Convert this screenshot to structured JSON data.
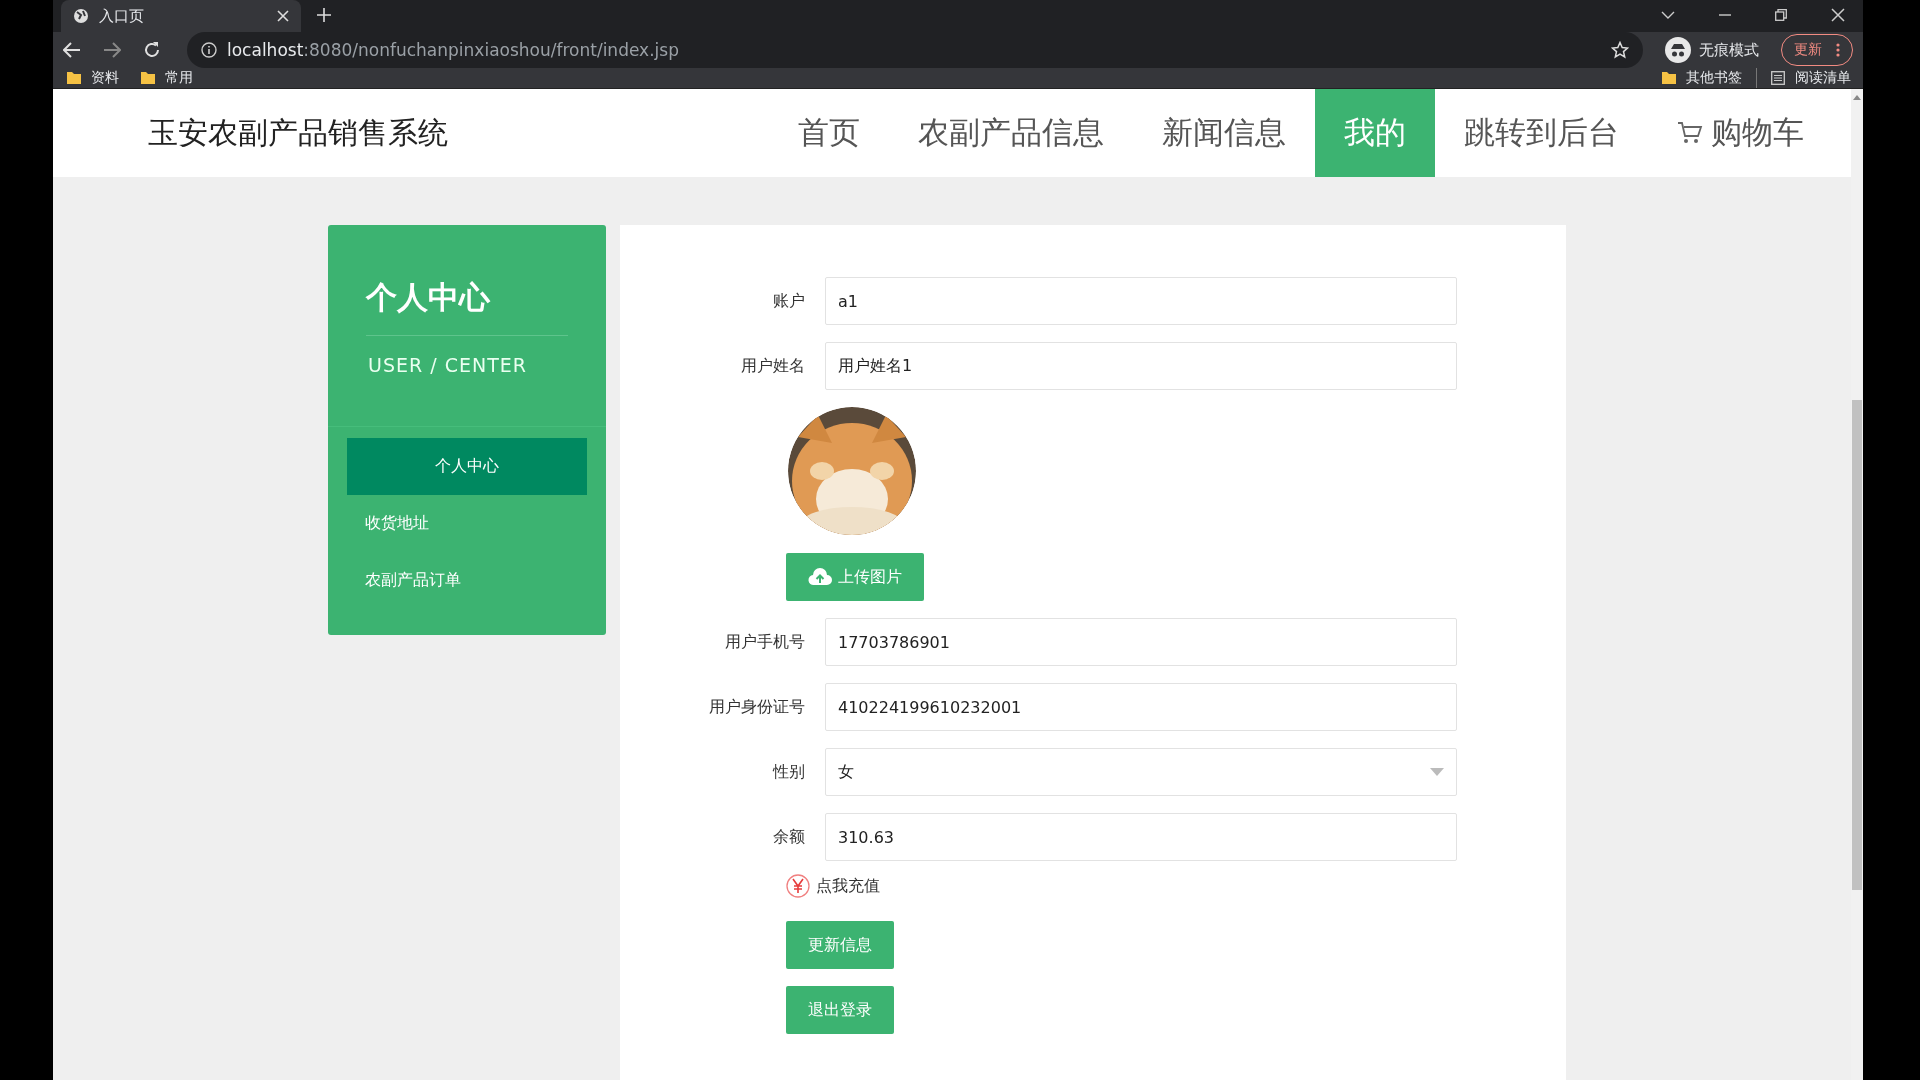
{
  "browser": {
    "tab": {
      "title": "入口页"
    },
    "url": "localhost:8080/nonfuchanpinxiaoshou/front/index.jsp",
    "profile": "无痕模式",
    "update": "更新",
    "bookmarks": [
      "资料",
      "常用"
    ],
    "bookmarks_right": [
      "其他书签",
      "阅读清单"
    ]
  },
  "site": {
    "title": "玉安农副产品销售系统",
    "nav": [
      {
        "label": "首页",
        "selected": false
      },
      {
        "label": "农副产品信息",
        "selected": false
      },
      {
        "label": "新闻信息",
        "selected": false
      },
      {
        "label": "我的",
        "selected": true
      },
      {
        "label": "跳转到后台",
        "selected": false
      },
      {
        "label": "购物车",
        "selected": false,
        "kind": "cart"
      }
    ]
  },
  "sidebar": {
    "title": "个人中心",
    "subtitle": "USER / CENTER",
    "items": [
      {
        "label": "个人中心",
        "selected": true
      },
      {
        "label": "收货地址",
        "selected": false
      },
      {
        "label": "农副产品订单",
        "selected": false
      }
    ]
  },
  "form": {
    "fields": [
      {
        "kind": "text",
        "label": "账户",
        "value": "a1"
      },
      {
        "kind": "text",
        "label": "用户姓名",
        "value": "用户姓名1"
      },
      {
        "kind": "avatar",
        "button": "上传图片"
      },
      {
        "kind": "text",
        "label": "用户手机号",
        "value": "17703786901"
      },
      {
        "kind": "text",
        "label": "用户身份证号",
        "value": "410224199610232001"
      },
      {
        "kind": "select",
        "label": "性别",
        "value": "女"
      },
      {
        "kind": "text",
        "label": "余额",
        "value": "310.63"
      },
      {
        "kind": "link",
        "label": "点我充值"
      }
    ],
    "buttons": [
      "更新信息",
      "退出登录"
    ]
  }
}
